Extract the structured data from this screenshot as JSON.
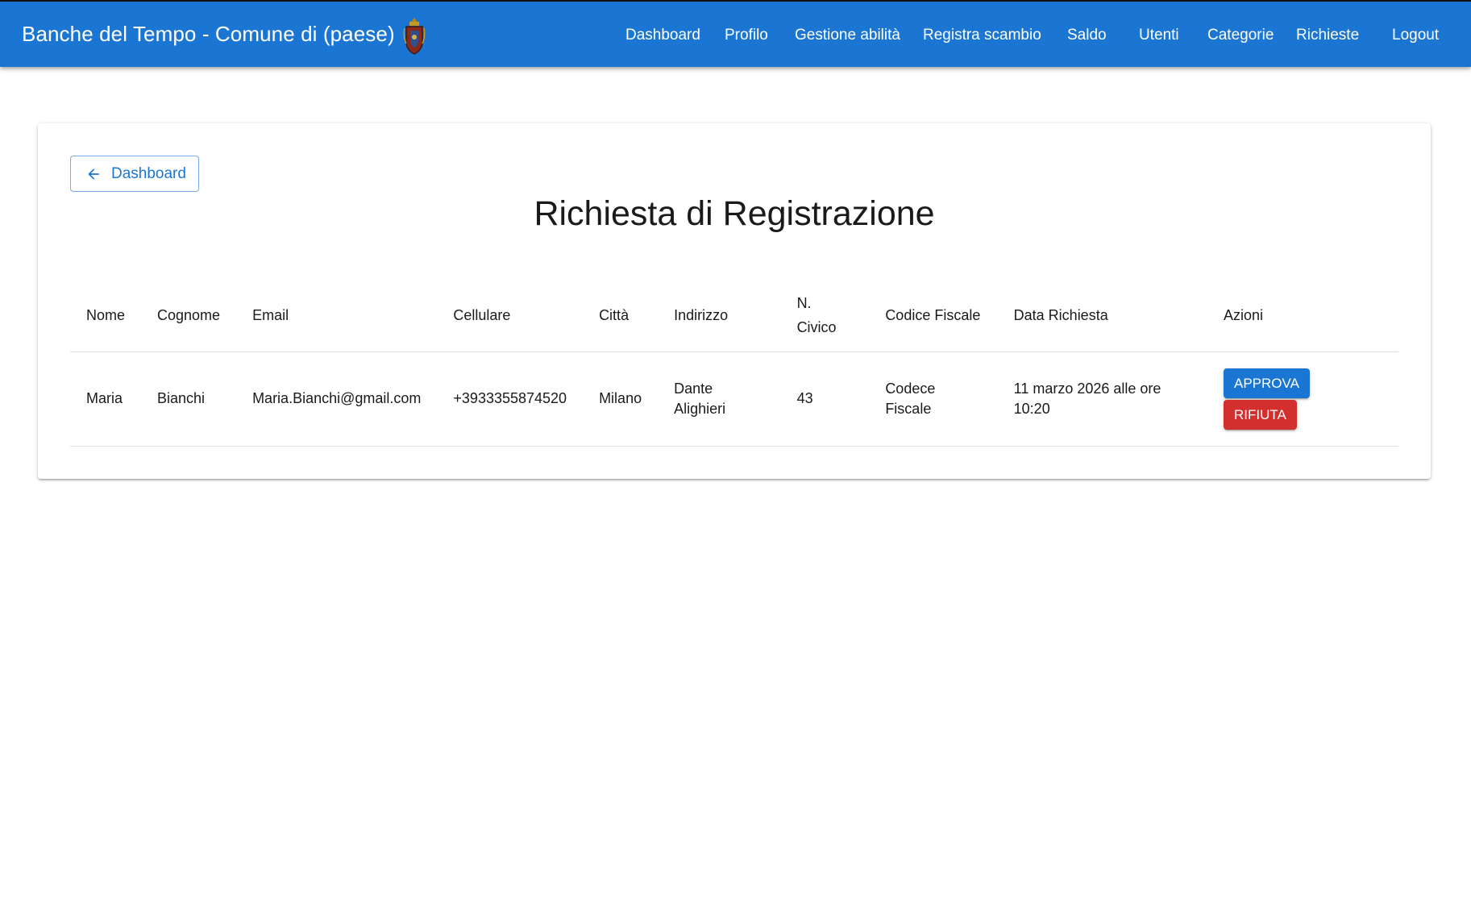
{
  "colors": {
    "primary": "#1b76d3",
    "danger": "#d32f2f"
  },
  "header": {
    "title": "Banche del Tempo - Comune di (paese)",
    "logo_icon": "crest-icon",
    "nav": [
      {
        "label": "Dashboard"
      },
      {
        "label": "Profilo"
      },
      {
        "label": "Gestione abilità"
      },
      {
        "label": "Registra scambio"
      },
      {
        "label": "Saldo"
      },
      {
        "label": "Utenti"
      },
      {
        "label": "Categorie"
      },
      {
        "label": "Richieste"
      },
      {
        "label": "Logout"
      }
    ]
  },
  "main": {
    "back_button": {
      "label": "Dashboard",
      "icon": "arrow-left-icon"
    },
    "title": "Richiesta di Registrazione",
    "table": {
      "headers": {
        "nome": "Nome",
        "cognome": "Cognome",
        "email": "Email",
        "cellulare": "Cellulare",
        "citta": "Città",
        "indirizzo": "Indirizzo",
        "civico": "N. Civico",
        "codice_fiscale": "Codice Fiscale",
        "data_richiesta": "Data Richiesta",
        "azioni": "Azioni"
      },
      "rows": [
        {
          "nome": "Maria",
          "cognome": "Bianchi",
          "email": "Maria.Bianchi@gmail.com",
          "cellulare": "+3933355874520",
          "citta": "Milano",
          "indirizzo": "Dante Alighieri",
          "civico": "43",
          "codice_fiscale": "Codece Fiscale",
          "data_richiesta": "11 marzo 2026 alle ore 10:20",
          "approve_label": "Approva",
          "reject_label": "Rifiuta"
        }
      ]
    }
  }
}
